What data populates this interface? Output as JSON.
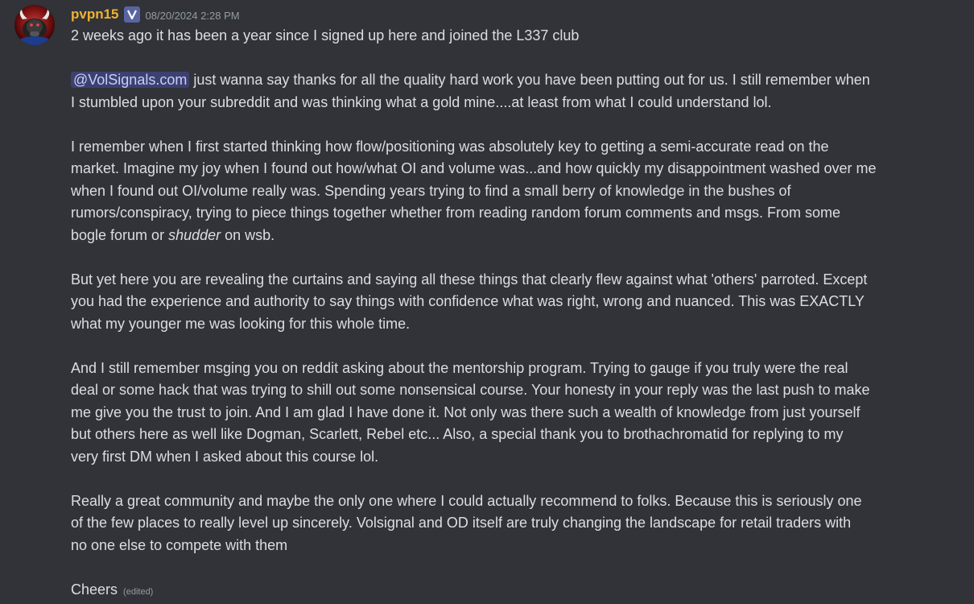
{
  "message": {
    "author": "pvpn15",
    "badge_icon": "role-badge-icon",
    "timestamp": "08/20/2024 2:28 PM",
    "colors": {
      "username": "#f0b232",
      "background": "#313338",
      "text": "#dbdee1",
      "mention_bg": "#3c4270",
      "mention_text": "#c9cdfb",
      "muted": "#949ba4"
    },
    "lines": {
      "l1": "2 weeks ago it has been a year since I signed up here and joined the L337 club",
      "mention": "@VolSignals.com",
      "l2_rest": " just wanna say thanks for all the quality hard work you have been putting out for us. I still remember when",
      "l3": "I stumbled upon your subreddit and was thinking what a gold mine....at least from what I could understand lol.",
      "l4": "I remember when I first started thinking how flow/positioning was absolutely key to getting a semi-accurate read on the",
      "l5": "market. Imagine my joy when I found out how/what OI and volume was...and how quickly my disappointment washed over me",
      "l6": "when I found out OI/volume really was. Spending years trying to find a small berry of knowledge in the bushes of",
      "l7": "rumors/conspiracy, trying to piece things together whether from reading random forum comments and msgs. From some",
      "l8_pre": "bogle forum or ",
      "l8_em": "shudder",
      "l8_post": " on wsb.",
      "l9": "But yet here you are revealing the curtains and saying all these things that clearly flew against what 'others' parroted. Except",
      "l10": "you had the experience and authority to say things with confidence what was right, wrong and nuanced. This was EXACTLY",
      "l11": "what my younger me was looking for this whole time.",
      "l12": "And I still remember msging you on reddit asking about the mentorship program. Trying to gauge if you truly were the real",
      "l13": "deal or some hack that was trying to shill out some nonsensical course. Your honesty in your reply was the last push to make",
      "l14": "me give you the trust to join. And I am glad I have done it. Not only was there such a wealth of knowledge from just yourself",
      "l15": "but others here as well like Dogman, Scarlett, Rebel etc... Also, a special thank you to brothachromatid for replying to my",
      "l16": "very first DM when I asked about this course lol.",
      "l17": "Really a great community and maybe the only one where I could actually recommend to folks. Because this is seriously one",
      "l18": "of the few places to really level up sincerely. Volsignal and OD itself are truly changing the landscape for retail traders with",
      "l19": "no one else to compete with them",
      "l20": "Cheers",
      "edited": "(edited)"
    }
  }
}
